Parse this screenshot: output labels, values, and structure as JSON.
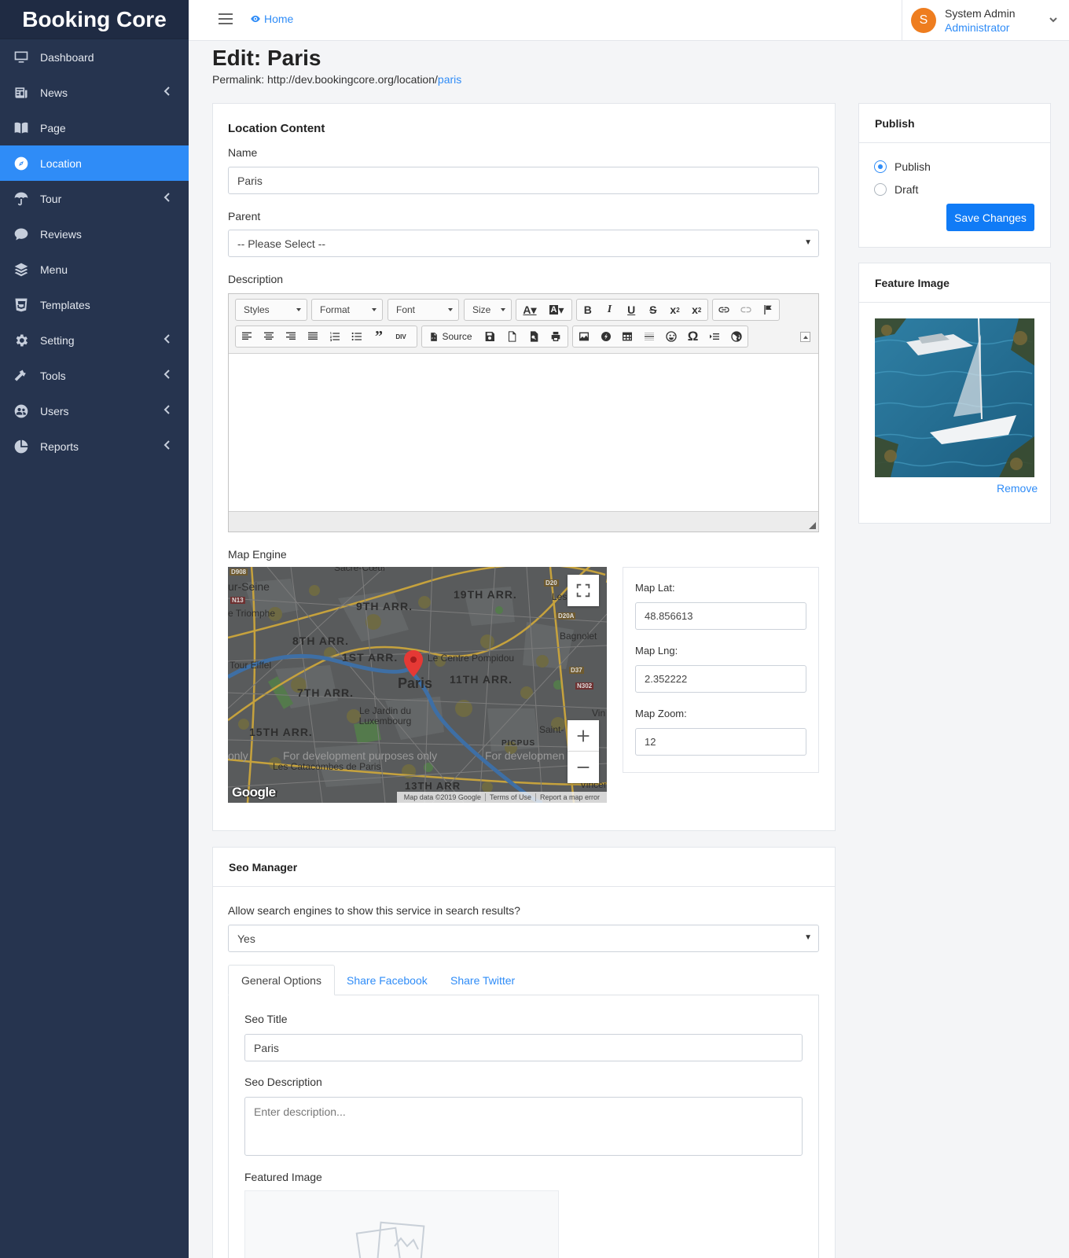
{
  "app": {
    "brand": "Booking Core"
  },
  "sidebar": {
    "items": [
      {
        "label": "Dashboard",
        "icon": "monitor-icon",
        "chevron": false,
        "active": false
      },
      {
        "label": "News",
        "icon": "newspaper-icon",
        "chevron": true,
        "active": false
      },
      {
        "label": "Page",
        "icon": "book-icon",
        "chevron": false,
        "active": false
      },
      {
        "label": "Location",
        "icon": "compass-icon",
        "chevron": false,
        "active": true
      },
      {
        "label": "Tour",
        "icon": "umbrella-icon",
        "chevron": true,
        "active": false
      },
      {
        "label": "Reviews",
        "icon": "comment-icon",
        "chevron": false,
        "active": false
      },
      {
        "label": "Menu",
        "icon": "layers-icon",
        "chevron": false,
        "active": false
      },
      {
        "label": "Templates",
        "icon": "html5-icon",
        "chevron": false,
        "active": false
      },
      {
        "label": "Setting",
        "icon": "gear-icon",
        "chevron": true,
        "active": false
      },
      {
        "label": "Tools",
        "icon": "hammer-icon",
        "chevron": true,
        "active": false
      },
      {
        "label": "Users",
        "icon": "users-icon",
        "chevron": true,
        "active": false
      },
      {
        "label": "Reports",
        "icon": "pie-chart-icon",
        "chevron": true,
        "active": false
      }
    ]
  },
  "topbar": {
    "home_label": "Home",
    "user": {
      "initial": "S",
      "name": "System Admin",
      "role": "Administrator"
    }
  },
  "page": {
    "title": "Edit: Paris",
    "permalink_prefix": "Permalink: http://dev.bookingcore.org/location/",
    "permalink_slug": "paris"
  },
  "content": {
    "section_title": "Location Content",
    "name_label": "Name",
    "name_value": "Paris",
    "parent_label": "Parent",
    "parent_value": "-- Please Select --",
    "description_label": "Description",
    "editor": {
      "styles": "Styles",
      "format": "Format",
      "font": "Font",
      "size": "Size",
      "source": "Source"
    },
    "map_label": "Map Engine",
    "map": {
      "labels": {
        "sacre": "Sacré-Cœur",
        "seine": "ur-Seine",
        "arr9": "9TH ARR.",
        "arr19": "19TH ARR.",
        "triomphe": "e Triomphe",
        "les": "Les",
        "bagnolet": "Bagnolet",
        "arr8": "8TH ARR.",
        "arr1": "1ST ARR.",
        "pompidou": "Le Centre Pompidou",
        "eiffel": "Tour Eiffel",
        "paris": "Paris",
        "arr11": "11TH ARR.",
        "arr7": "7TH ARR.",
        "vin": "Vin",
        "jardin": "Le Jardin du Luxembourg",
        "arr15": "15TH ARR.",
        "saint": "Saint-",
        "picpus": "PICPUS",
        "dev_only": "only",
        "dev1": "For development purposes only",
        "dev2": "For developmen",
        "catacombes": "Les Catacombes de Paris",
        "arr13": "13TH ARR",
        "vincen": "Vincen",
        "malakoff": "Malakoff",
        "d20": "D20",
        "d20a": "D20A",
        "d37": "D37",
        "n302": "N302",
        "d908": "D908",
        "n13": "N13"
      },
      "google": "Google",
      "footer": [
        "Map data ©2019 Google",
        "Terms of Use",
        "Report a map error"
      ]
    },
    "map_lat_label": "Map Lat:",
    "map_lat_value": "48.856613",
    "map_lng_label": "Map Lng:",
    "map_lng_value": "2.352222",
    "map_zoom_label": "Map Zoom:",
    "map_zoom_value": "12"
  },
  "publish": {
    "title": "Publish",
    "options": [
      "Publish",
      "Draft"
    ],
    "selected": "Publish",
    "save_label": "Save Changes"
  },
  "feature_image": {
    "title": "Feature Image",
    "remove_label": "Remove"
  },
  "seo": {
    "title": "Seo Manager",
    "allow_label": "Allow search engines to show this service in search results?",
    "allow_value": "Yes",
    "tabs": [
      "General Options",
      "Share Facebook",
      "Share Twitter"
    ],
    "active_tab": "General Options",
    "seo_title_label": "Seo Title",
    "seo_title_value": "Paris",
    "seo_desc_label": "Seo Description",
    "seo_desc_placeholder": "Enter description...",
    "featured_image_label": "Featured Image"
  },
  "colors": {
    "sidebar_bg": "#26344f",
    "accent": "#2f8cf7",
    "avatar": "#ee7d1f",
    "primary_button": "#107bf6"
  }
}
